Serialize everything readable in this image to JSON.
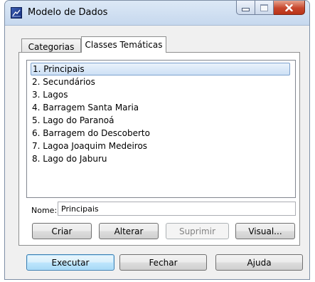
{
  "window": {
    "title": "Modelo de Dados",
    "icon": "database-model-icon",
    "controls": [
      "minimize-icon",
      "maximize-icon",
      "close-icon"
    ]
  },
  "tabs": [
    {
      "label": "Categorias",
      "active": false
    },
    {
      "label": "Classes Temáticas",
      "active": true
    }
  ],
  "list": {
    "items": [
      {
        "label": "1. Principais",
        "selected": true
      },
      {
        "label": "2. Secundários",
        "selected": false
      },
      {
        "label": "3. Lagos",
        "selected": false
      },
      {
        "label": "4. Barragem Santa Maria",
        "selected": false
      },
      {
        "label": "5. Lago do Paranoá",
        "selected": false
      },
      {
        "label": "6. Barragem do Descoberto",
        "selected": false
      },
      {
        "label": "7. Lagoa Joaquim Medeiros",
        "selected": false
      },
      {
        "label": "8. Lago do Jaburu",
        "selected": false
      }
    ]
  },
  "name_field": {
    "label": "Nome:",
    "value": "Principais"
  },
  "edit_buttons": {
    "create": "Criar",
    "alter": "Alterar",
    "delete": "Suprimir",
    "visual": "Visual..."
  },
  "footer_buttons": {
    "execute": "Executar",
    "close": "Fechar",
    "help": "Ajuda"
  },
  "colors": {
    "selection_border": "#7da2ce",
    "default_button_border": "#3c7fb1",
    "close_button": "#c7462c"
  }
}
